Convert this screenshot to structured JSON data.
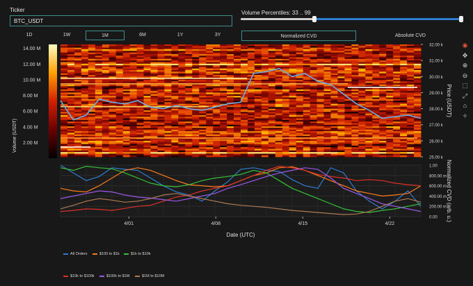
{
  "ticker": {
    "label": "Ticker",
    "value": "BTC_USDT"
  },
  "timeframes": [
    "1D",
    "1W",
    "1M",
    "6M",
    "1Y",
    "3Y"
  ],
  "timeframe_active": "1M",
  "volume_percentiles": {
    "label": "Volume Percentiles: 33 .. 99",
    "low": 33,
    "high": 99
  },
  "cvd_modes": [
    "Normalized CVD",
    "Absolute CVD"
  ],
  "cvd_mode_active": "Normalized CVD",
  "toolbar_icons": [
    "color-wheel-icon",
    "move-icon",
    "zoom-in-icon",
    "zoom-out-icon",
    "zoom-box-icon",
    "autoscale-icon",
    "reset-icon",
    "hover-icon"
  ],
  "chart_data": [
    {
      "type": "heatmap",
      "xlabel": "Date (UTC)",
      "ylabel_left": "Volume (USDT)",
      "ylabel_right": "Price (USDT)",
      "x_ticks": [
        "4/01",
        "4/08",
        "4/15",
        "4/22"
      ],
      "y_ticks_price": [
        "25.00 k",
        "26.00 k",
        "27.00 k",
        "28.00 k",
        "29.00 k",
        "30.00 k",
        "31.00 k",
        "32.00 k"
      ],
      "price_range": [
        25000,
        32000
      ],
      "colorbar_ticks": [
        "2.00 M",
        "4.00 M",
        "6.00 M",
        "8.00 M",
        "10.00 M",
        "12.00 M",
        "14.00 M"
      ],
      "colorbar_range": [
        0,
        14500000
      ],
      "price_series": {
        "name": "",
        "x_days": [
          0,
          1,
          2,
          3,
          4,
          5,
          6,
          7,
          8,
          9,
          10,
          11,
          12,
          13,
          14,
          15,
          16,
          17,
          18,
          19,
          20,
          21,
          22,
          23,
          24,
          25,
          26,
          27,
          28
        ],
        "values": [
          28500,
          27300,
          27600,
          28600,
          28400,
          28300,
          28500,
          28100,
          28000,
          28200,
          28000,
          27900,
          28100,
          28300,
          28400,
          30200,
          30300,
          30500,
          30000,
          30200,
          29700,
          29500,
          28900,
          28300,
          27900,
          27400,
          27500,
          27600,
          27400
        ]
      }
    },
    {
      "type": "line",
      "ylabel": "Normalized CVD (arb. u.)",
      "y_ticks": [
        "0.00",
        "200.00 m",
        "400.00 m",
        "600.00 m",
        "800.00 m",
        "1.00"
      ],
      "ylim": [
        0,
        1
      ],
      "series": [
        {
          "name": "All Orders",
          "color": "#2e7dd1",
          "values": [
            1.0,
            0.85,
            0.7,
            0.78,
            0.95,
            0.92,
            0.9,
            0.75,
            0.6,
            0.48,
            0.42,
            0.3,
            0.5,
            0.68,
            0.92,
            0.95,
            0.9,
            0.88,
            0.72,
            0.6,
            0.55,
            0.95,
            0.85,
            0.5,
            0.3,
            0.15,
            0.3,
            0.5,
            0.2
          ]
        },
        {
          "name": "$100 to $1k",
          "color": "#ff7a1a",
          "values": [
            0.55,
            0.5,
            0.48,
            0.6,
            0.75,
            0.9,
            0.95,
            0.9,
            0.8,
            0.7,
            0.62,
            0.6,
            0.58,
            0.6,
            0.7,
            0.8,
            0.85,
            0.95,
            0.97,
            0.9,
            0.8,
            0.7,
            0.6,
            0.5,
            0.45,
            0.4,
            0.42,
            0.45,
            0.6
          ]
        },
        {
          "name": "$1k to $10k",
          "color": "#36c23a",
          "values": [
            0.95,
            0.9,
            0.98,
            0.95,
            0.93,
            0.85,
            0.75,
            0.65,
            0.6,
            0.58,
            0.62,
            0.7,
            0.75,
            0.78,
            0.82,
            0.9,
            0.85,
            0.7,
            0.55,
            0.45,
            0.35,
            0.25,
            0.15,
            0.1,
            0.08,
            0.12,
            0.15,
            0.2,
            0.25
          ]
        },
        {
          "name": "$10k to $100k",
          "color": "#e0302a",
          "values": [
            0.1,
            0.12,
            0.15,
            0.14,
            0.12,
            0.16,
            0.2,
            0.22,
            0.3,
            0.38,
            0.42,
            0.5,
            0.55,
            0.6,
            0.7,
            0.8,
            0.9,
            0.98,
            0.95,
            0.9,
            0.82,
            0.78,
            0.75,
            0.7,
            0.72,
            0.7,
            0.65,
            0.62,
            0.6
          ]
        },
        {
          "name": "$100k to $1M",
          "color": "#9b59e8",
          "values": [
            0.35,
            0.4,
            0.45,
            0.5,
            0.48,
            0.42,
            0.38,
            0.36,
            0.33,
            0.3,
            0.35,
            0.4,
            0.45,
            0.55,
            0.62,
            0.7,
            0.78,
            0.85,
            0.9,
            0.95,
            0.92,
            0.75,
            0.55,
            0.45,
            0.35,
            0.25,
            0.2,
            0.15,
            0.1
          ]
        },
        {
          "name": "$1M to $10M",
          "color": "#b07a52",
          "values": [
            0.15,
            0.22,
            0.3,
            0.35,
            0.32,
            0.28,
            0.3,
            0.35,
            0.42,
            0.45,
            0.4,
            0.35,
            0.3,
            0.25,
            0.22,
            0.2,
            0.18,
            0.15,
            0.12,
            0.1,
            0.08,
            0.06,
            0.04,
            0.05,
            0.1,
            0.2,
            0.3,
            0.35,
            0.28
          ]
        }
      ]
    }
  ]
}
